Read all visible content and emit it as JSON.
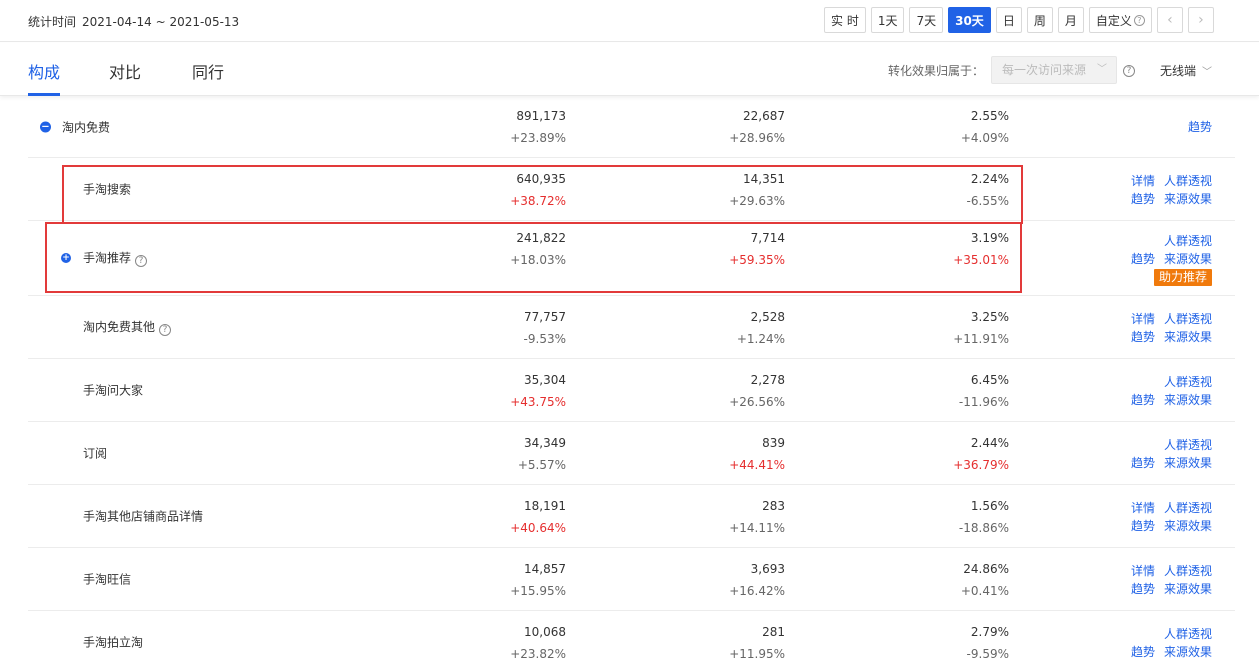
{
  "header": {
    "range_label": "统计时间",
    "range_value": "2021-04-14 ~ 2021-05-13",
    "periods": [
      {
        "label": "实 时",
        "active": false
      },
      {
        "label": "1天",
        "active": false
      },
      {
        "label": "7天",
        "active": false
      },
      {
        "label": "30天",
        "active": true
      },
      {
        "label": "日",
        "active": false
      },
      {
        "label": "周",
        "active": false
      },
      {
        "label": "月",
        "active": false
      },
      {
        "label": "自定义",
        "active": false
      }
    ],
    "help_glyph": "?",
    "prev_glyph": "‹",
    "next_glyph": "›"
  },
  "tabs": [
    {
      "label": "构成",
      "active": true
    },
    {
      "label": "对比",
      "active": false
    },
    {
      "label": "同行",
      "active": false
    }
  ],
  "filter": {
    "attribution_label": "转化效果归属于：",
    "attribution_value": "每一次访问来源",
    "device": "无线端"
  },
  "colors": {
    "accent": "#2062e6",
    "increase": "#e52e2e",
    "neutral_change": "#666666",
    "boost_badge": "#f07a0c",
    "highlight_box": "#e23a3a"
  },
  "rows": [
    {
      "name": "淘内免费",
      "level": 1,
      "expand": "minus",
      "m1": "891,173",
      "c1": "+23.89%",
      "m2": "22,687",
      "c2": "+28.96%",
      "m3": "2.55%",
      "c3": "+4.09%",
      "links": [
        [
          "趋势"
        ]
      ]
    },
    {
      "name": "手淘搜索",
      "level": 2,
      "m1": "640,935",
      "c1": "+38.72%",
      "c1up": true,
      "m2": "14,351",
      "c2": "+29.63%",
      "m3": "2.24%",
      "c3": "-6.55%",
      "links": [
        [
          "详情",
          "人群透视"
        ],
        [
          "趋势",
          "来源效果"
        ]
      ]
    },
    {
      "name": "手淘推荐",
      "level": 2,
      "expand": "plus",
      "help": true,
      "m1": "241,822",
      "c1": "+18.03%",
      "m2": "7,714",
      "c2": "+59.35%",
      "c2up": true,
      "m3": "3.19%",
      "c3": "+35.01%",
      "c3up": true,
      "links": [
        [
          "人群透视"
        ],
        [
          "趋势",
          "来源效果"
        ]
      ],
      "badge": "助力推荐"
    },
    {
      "name": "淘内免费其他",
      "level": 2,
      "help": true,
      "m1": "77,757",
      "c1": "-9.53%",
      "m2": "2,528",
      "c2": "+1.24%",
      "m3": "3.25%",
      "c3": "+11.91%",
      "links": [
        [
          "详情",
          "人群透视"
        ],
        [
          "趋势",
          "来源效果"
        ]
      ]
    },
    {
      "name": "手淘问大家",
      "level": 2,
      "m1": "35,304",
      "c1": "+43.75%",
      "c1up": true,
      "m2": "2,278",
      "c2": "+26.56%",
      "m3": "6.45%",
      "c3": "-11.96%",
      "links": [
        [
          "人群透视"
        ],
        [
          "趋势",
          "来源效果"
        ]
      ]
    },
    {
      "name": "订阅",
      "level": 2,
      "m1": "34,349",
      "c1": "+5.57%",
      "m2": "839",
      "c2": "+44.41%",
      "c2up": true,
      "m3": "2.44%",
      "c3": "+36.79%",
      "c3up": true,
      "links": [
        [
          "人群透视"
        ],
        [
          "趋势",
          "来源效果"
        ]
      ]
    },
    {
      "name": "手淘其他店铺商品详情",
      "level": 2,
      "m1": "18,191",
      "c1": "+40.64%",
      "c1up": true,
      "m2": "283",
      "c2": "+14.11%",
      "m3": "1.56%",
      "c3": "-18.86%",
      "links": [
        [
          "详情",
          "人群透视"
        ],
        [
          "趋势",
          "来源效果"
        ]
      ]
    },
    {
      "name": "手淘旺信",
      "level": 2,
      "m1": "14,857",
      "c1": "+15.95%",
      "m2": "3,693",
      "c2": "+16.42%",
      "m3": "24.86%",
      "c3": "+0.41%",
      "links": [
        [
          "详情",
          "人群透视"
        ],
        [
          "趋势",
          "来源效果"
        ]
      ]
    },
    {
      "name": "手淘拍立淘",
      "level": 2,
      "m1": "10,068",
      "c1": "+23.82%",
      "m2": "281",
      "c2": "+11.95%",
      "m3": "2.79%",
      "c3": "-9.59%",
      "links": [
        [
          "人群透视"
        ],
        [
          "趋势",
          "来源效果"
        ]
      ]
    }
  ]
}
